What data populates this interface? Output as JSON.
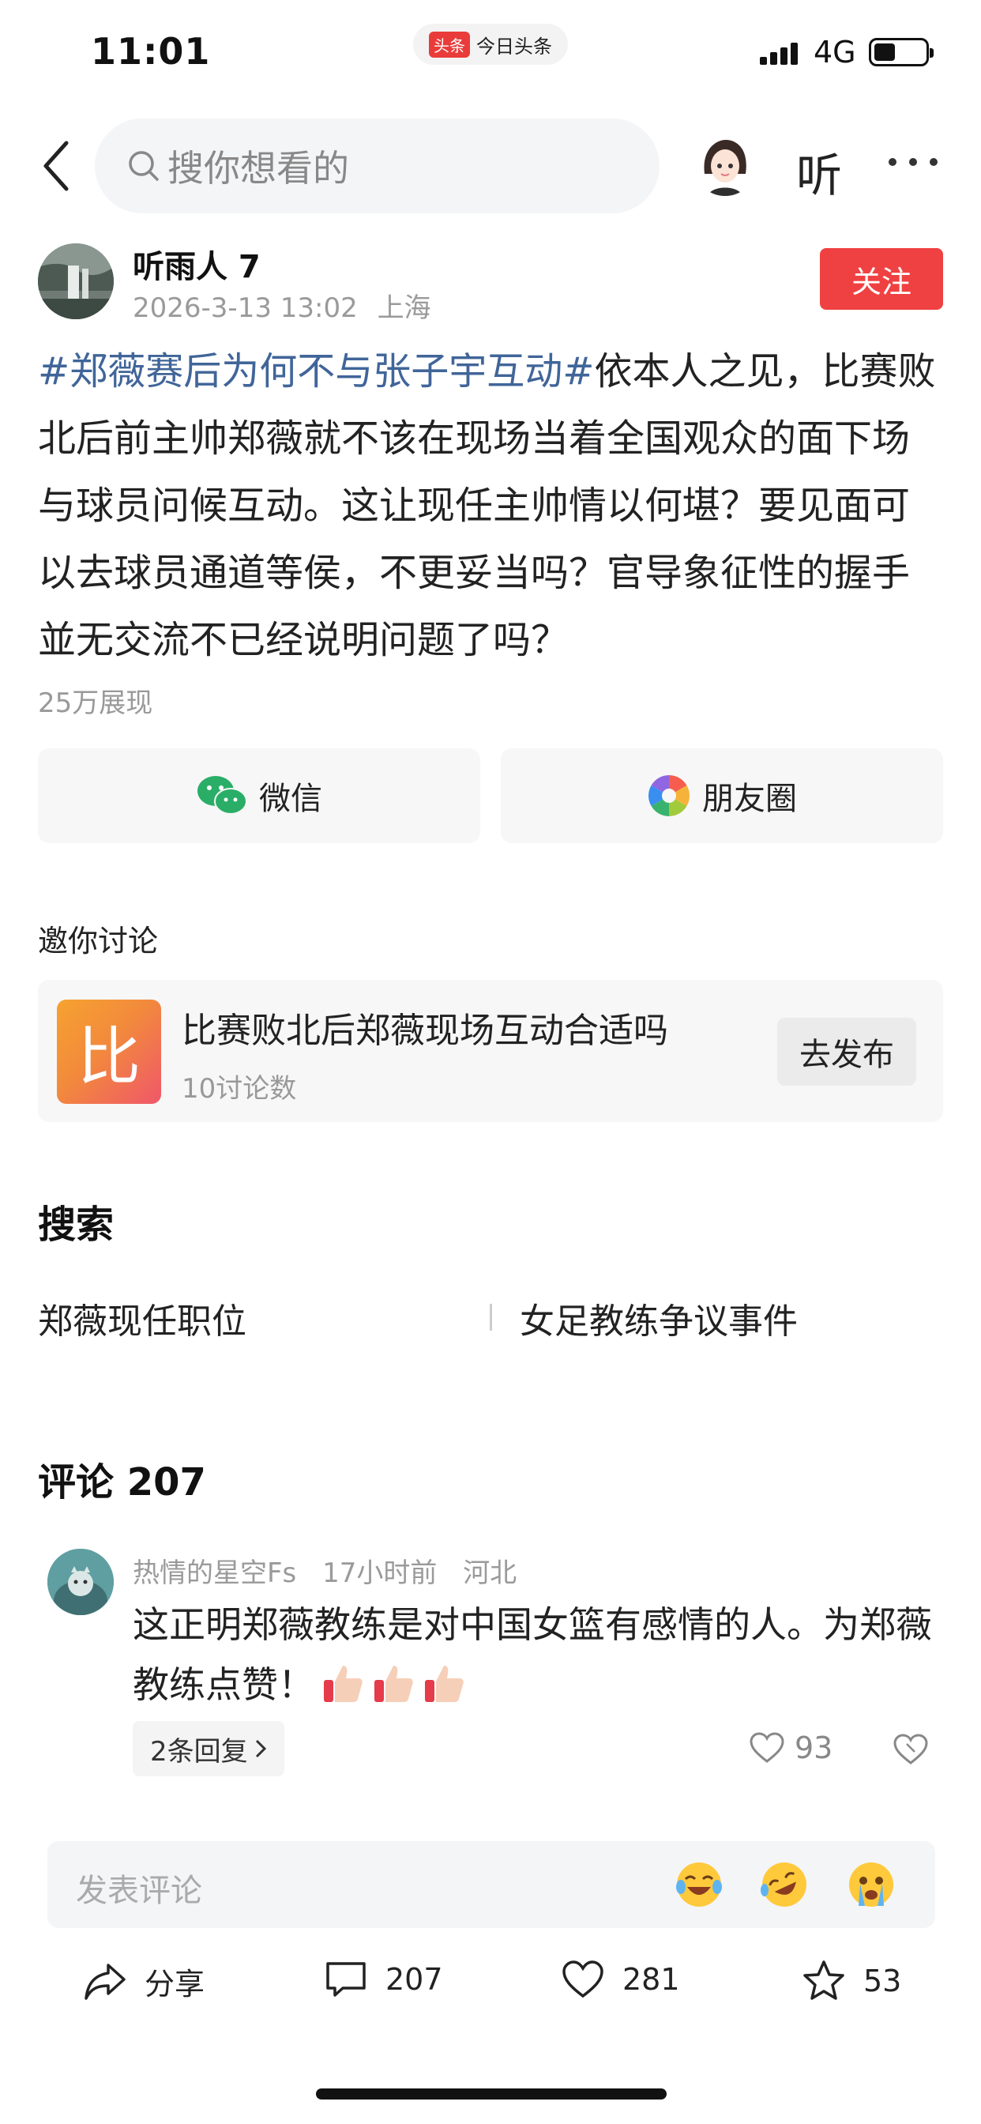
{
  "status_bar": {
    "time": "11:01",
    "app_badge": "头条",
    "app_name": "今日头条",
    "network": "4G"
  },
  "header": {
    "search_placeholder": "搜你想看的",
    "listen_label": "听"
  },
  "author": {
    "name": "听雨人 7",
    "date": "2026-3-13 13:02",
    "location": "上海",
    "follow_label": "关注"
  },
  "post": {
    "hashtag": "#郑薇赛后为何不与张子宇互动#",
    "body": "依本人之见，比赛败北后前主帅郑薇就不该在现场当着全国观众的面下场与球员问候互动。这让现任主帅情以何堪？要见面可以去球员通道等侯，不更妥当吗？官导象征性的握手並无交流不已经说明问题了吗？",
    "views": "25万展现"
  },
  "share": {
    "wechat_label": "微信",
    "moments_label": "朋友圈"
  },
  "invite": {
    "section_title": "邀你讨论",
    "icon_char": "比",
    "topic": "比赛败北后郑薇现场互动合适吗",
    "count": "10讨论数",
    "button": "去发布"
  },
  "search": {
    "title": "搜索",
    "queries": [
      "郑薇现任职位",
      "女足教练争议事件"
    ]
  },
  "comments": {
    "title": "评论 207",
    "items": [
      {
        "user": "热情的星空Fs",
        "time": "17小时前",
        "location": "河北",
        "text": "这正明郑薇教练是对中国女篮有感情的人。为郑薇教练点赞！",
        "replies": "2条回复",
        "likes": "93"
      }
    ]
  },
  "comment_input": {
    "placeholder": "发表评论"
  },
  "bottom_bar": {
    "share_label": "分享",
    "comment_count": "207",
    "like_count": "281",
    "star_count": "53"
  }
}
